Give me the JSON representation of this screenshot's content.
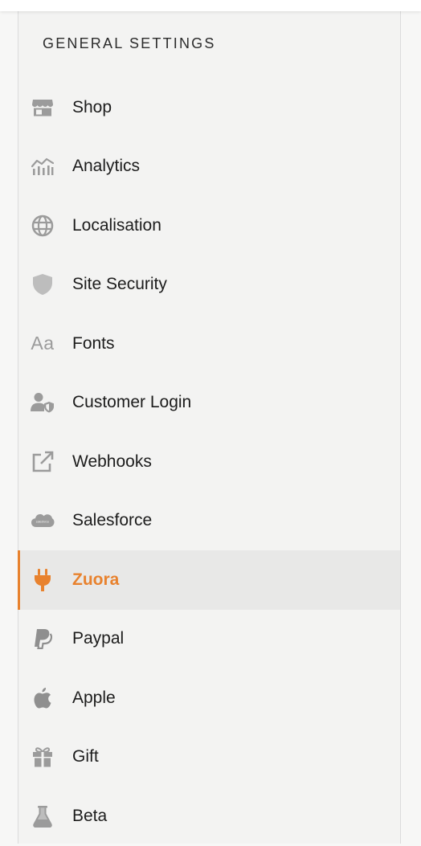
{
  "sidebar": {
    "section_title": "GENERAL SETTINGS",
    "active_item": "Zuora",
    "accent_color": "#e8822e",
    "icon_color": "#9b9b9b",
    "items": [
      {
        "label": "Shop",
        "icon": "storefront-icon"
      },
      {
        "label": "Analytics",
        "icon": "analytics-icon"
      },
      {
        "label": "Localisation",
        "icon": "globe-icon"
      },
      {
        "label": "Site Security",
        "icon": "shield-icon"
      },
      {
        "label": "Fonts",
        "icon": "font-icon",
        "icon_text": "Aa"
      },
      {
        "label": "Customer Login",
        "icon": "user-shield-icon"
      },
      {
        "label": "Webhooks",
        "icon": "external-link-icon"
      },
      {
        "label": "Salesforce",
        "icon": "salesforce-icon",
        "icon_text": "salesforce"
      },
      {
        "label": "Zuora",
        "icon": "plug-icon"
      },
      {
        "label": "Paypal",
        "icon": "paypal-icon"
      },
      {
        "label": "Apple",
        "icon": "apple-icon"
      },
      {
        "label": "Gift",
        "icon": "gift-icon"
      },
      {
        "label": "Beta",
        "icon": "flask-icon"
      }
    ]
  }
}
